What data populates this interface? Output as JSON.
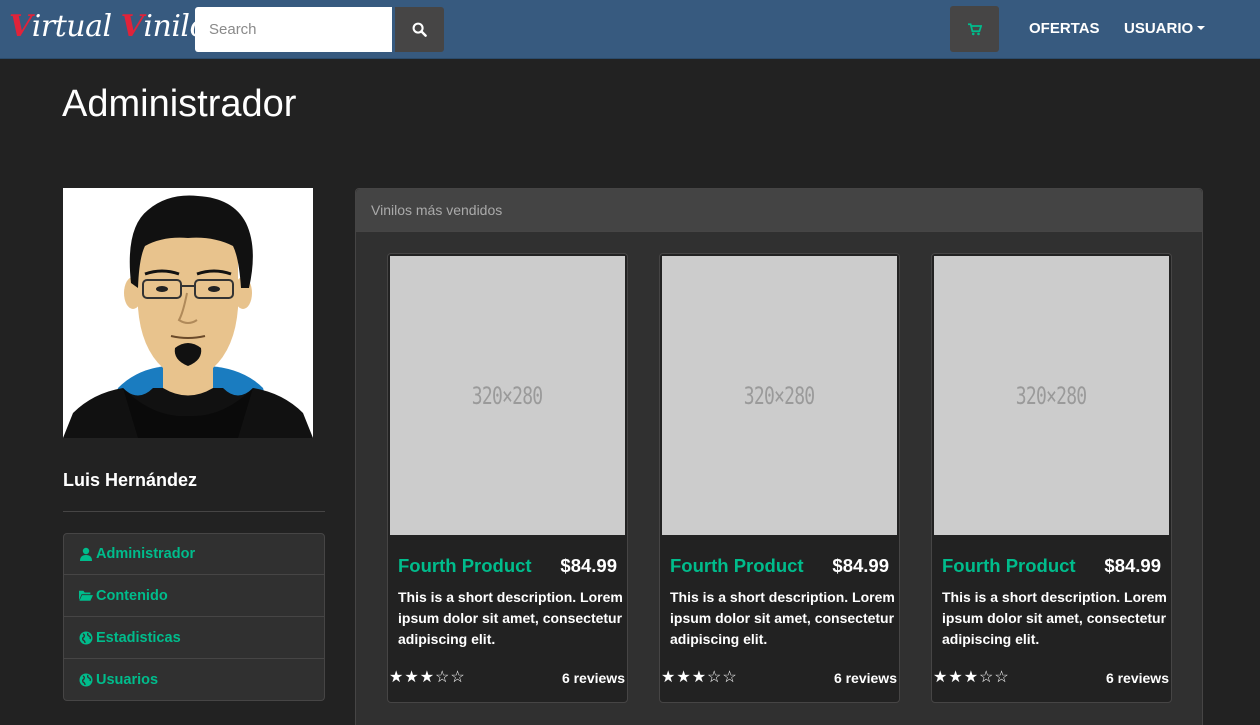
{
  "navbar": {
    "brand_v1": "V",
    "brand_rest1": "irtual ",
    "brand_v2": "V",
    "brand_rest2": "inilo",
    "search_placeholder": "Search",
    "links": [
      "OFERTAS",
      "USUARIO"
    ],
    "accent_color": "#00bc8c",
    "brand_color": "#e0233a"
  },
  "page": {
    "title": "Administrador"
  },
  "profile": {
    "name": "Luis Hernández"
  },
  "menu": {
    "items": [
      {
        "label": "Administrador",
        "icon": "user-icon"
      },
      {
        "label": "Contenido",
        "icon": "folder-open-icon"
      },
      {
        "label": "Estadisticas",
        "icon": "globe-icon"
      },
      {
        "label": "Usuarios",
        "icon": "globe-icon"
      }
    ]
  },
  "panel": {
    "heading": "Vinilos más vendidos"
  },
  "products": [
    {
      "image_label": "320×280",
      "title": "Fourth Product",
      "price": "$84.99",
      "description": "This is a short description. Lorem ipsum dolor sit amet, consectetur adipiscing elit.",
      "rating": 3,
      "max_rating": 5,
      "reviews": "6 reviews"
    },
    {
      "image_label": "320×280",
      "title": "Fourth Product",
      "price": "$84.99",
      "description": "This is a short description. Lorem ipsum dolor sit amet, consectetur adipiscing elit.",
      "rating": 3,
      "max_rating": 5,
      "reviews": "6 reviews"
    },
    {
      "image_label": "320×280",
      "title": "Fourth Product",
      "price": "$84.99",
      "description": "This is a short description. Lorem ipsum dolor sit amet, consectetur adipiscing elit.",
      "rating": 3,
      "max_rating": 5,
      "reviews": "6 reviews"
    }
  ]
}
